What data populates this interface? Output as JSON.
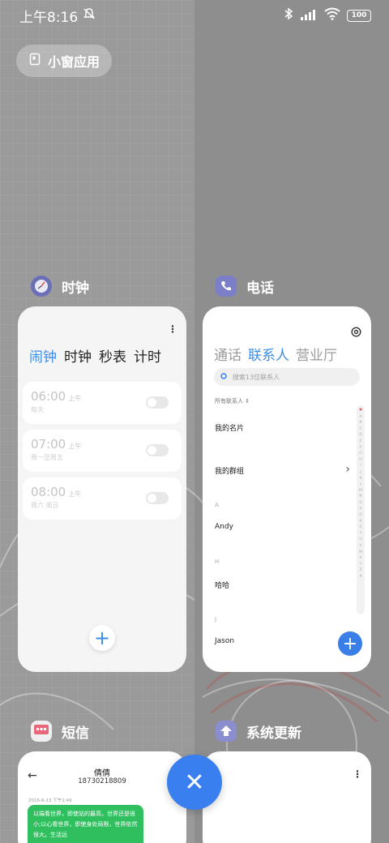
{
  "status_bar": {
    "time": "上午8:16",
    "battery": "100"
  },
  "floating_pill": {
    "label": "小窗应用"
  },
  "apps": {
    "clock": {
      "name": "时钟",
      "tabs": [
        "闹钟",
        "时钟",
        "秒表",
        "计时"
      ],
      "alarms": [
        {
          "time": "06:00",
          "ampm": "上午",
          "repeat": "每天"
        },
        {
          "time": "07:00",
          "ampm": "上午",
          "repeat": "周一至周五"
        },
        {
          "time": "08:00",
          "ampm": "上午",
          "repeat": "周六 周日"
        }
      ],
      "add": "+"
    },
    "phone": {
      "name": "电话",
      "tabs": [
        "通话",
        "联系人",
        "营业厅"
      ],
      "search_placeholder": "搜索13位联系人",
      "filter_label": "所有联系人",
      "my_card": "我的名片",
      "my_groups": "我的群组",
      "sections": [
        {
          "letter": "A",
          "contact": "Andy"
        },
        {
          "letter": "H",
          "contact": "哈哈"
        },
        {
          "letter": "J",
          "contact": "Jason"
        }
      ],
      "index_letters": [
        "♥",
        "A",
        "B",
        "C",
        "D",
        "E",
        "F",
        "G",
        "H",
        "I",
        "J",
        "K",
        "L",
        "M",
        "N",
        "O",
        "P",
        "Q",
        "R",
        "S",
        "T",
        "U",
        "V",
        "W",
        "X",
        "Y",
        "Z",
        "#"
      ],
      "add": "+"
    },
    "sms": {
      "name": "短信",
      "contact_name": "倩倩",
      "contact_number": "18730218809",
      "date": "2016-6-13 下午1:49",
      "message": "以端看世界，即使站的最高，世界还是很小;以心看世界，即使身处局限，世界依然很大。生活远"
    },
    "update": {
      "name": "系统更新"
    }
  },
  "close_button": "✕",
  "colors": {
    "accent": "#3a8de8",
    "fab_blue": "#3a7ff0",
    "sms_green": "#2fbf5f"
  }
}
